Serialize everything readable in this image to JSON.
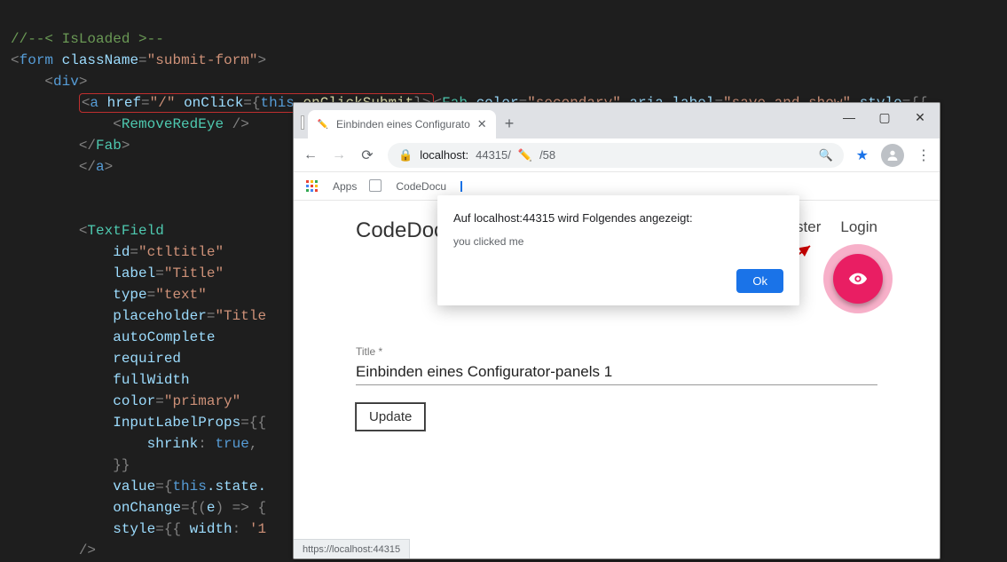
{
  "code": {
    "comment": "//--< IsLoaded >--",
    "form_class": "\"submit-form\"",
    "a_href": "\"/\"",
    "a_onclick_this": "this",
    "a_onclick_method": ".onClickSubmit",
    "fab_color": "\"secondary\"",
    "fab_aria": "\"save and show\"",
    "textfield_id": "\"ctltitle\"",
    "textfield_label": "\"Title\"",
    "textfield_type": "\"text\"",
    "textfield_placeholder": "\"Title",
    "textfield_color": "\"primary\"",
    "shrink_val": "true",
    "value_this": "this",
    "value_state": ".state.",
    "style_width_val": "'1"
  },
  "browser": {
    "tab_title": "Einbinden eines Configurato",
    "url_host": "localhost:",
    "url_port": "44315/",
    "url_tail": "/58",
    "bookmarks": {
      "apps": "Apps",
      "codedocu": "CodeDocu"
    },
    "status_url": "https://localhost:44315"
  },
  "dialog": {
    "header": "Auf localhost:44315 wird Folgendes angezeigt:",
    "message": "you clicked me",
    "ok": "Ok"
  },
  "app": {
    "brand": "CodeDocu",
    "nav": {
      "register_tail": "ister",
      "login": "Login"
    },
    "field_label": "Title *",
    "field_value": "Einbinden eines Configurator-panels 1",
    "update": "Update"
  }
}
